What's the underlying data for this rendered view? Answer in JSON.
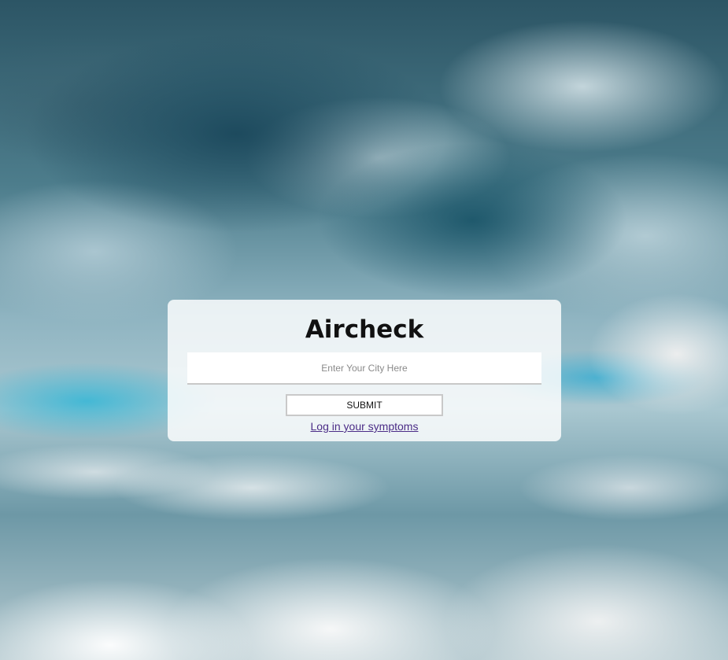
{
  "page": {
    "title": "Aircheck"
  },
  "search": {
    "placeholder": "Enter Your City Here",
    "value": ""
  },
  "actions": {
    "submit_label": "SUBMIT",
    "symptoms_link_label": "Log in your symptoms"
  },
  "colors": {
    "card_background": "#ffffff",
    "link": "#4b2c87",
    "title": "#111111"
  }
}
